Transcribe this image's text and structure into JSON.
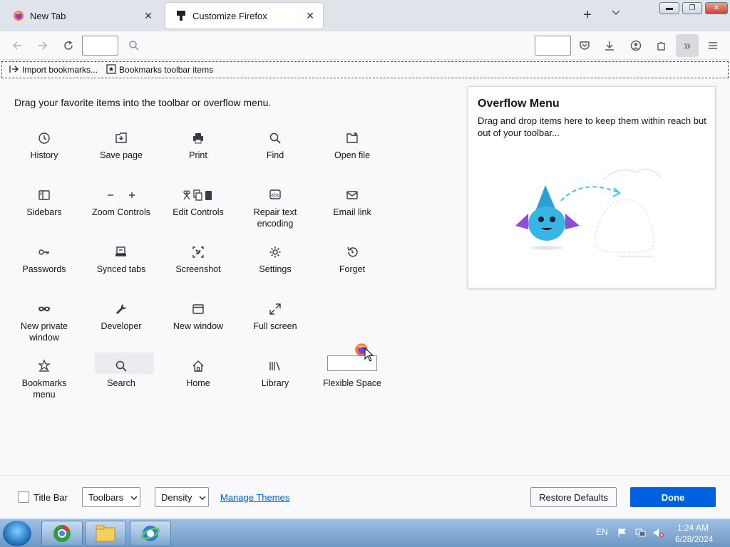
{
  "tabs": [
    {
      "label": "New Tab",
      "active": false
    },
    {
      "label": "Customize Firefox",
      "active": true
    }
  ],
  "bookmarks": [
    {
      "label": "Import bookmarks...",
      "icon": "import-icon"
    },
    {
      "label": "Bookmarks toolbar items",
      "icon": "star-box-icon"
    }
  ],
  "palette": {
    "title": "Drag your favorite items into the toolbar or overflow menu.",
    "items": [
      {
        "label": "History",
        "icon": "clock-icon"
      },
      {
        "label": "Save page",
        "icon": "save-page-icon"
      },
      {
        "label": "Print",
        "icon": "printer-icon"
      },
      {
        "label": "Find",
        "icon": "magnifier-icon"
      },
      {
        "label": "Open file",
        "icon": "open-file-icon"
      },
      {
        "label": "Sidebars",
        "icon": "sidebar-icon"
      },
      {
        "label": "Zoom Controls",
        "icon": "zoom-icon"
      },
      {
        "label": "Edit Controls",
        "icon": "edit-controls-icon"
      },
      {
        "label": "Repair text encoding",
        "icon": "text-encoding-icon"
      },
      {
        "label": "Email link",
        "icon": "envelope-icon"
      },
      {
        "label": "Passwords",
        "icon": "key-icon"
      },
      {
        "label": "Synced tabs",
        "icon": "synced-tabs-icon"
      },
      {
        "label": "Screenshot",
        "icon": "screenshot-icon"
      },
      {
        "label": "Settings",
        "icon": "gear-icon"
      },
      {
        "label": "Forget",
        "icon": "forget-icon"
      },
      {
        "label": "New private window",
        "icon": "mask-icon"
      },
      {
        "label": "Developer",
        "icon": "wrench-icon"
      },
      {
        "label": "New window",
        "icon": "window-icon"
      },
      {
        "label": "Full screen",
        "icon": "expand-icon"
      },
      {
        "label": "Bookmarks menu",
        "icon": "bookmarks-menu-icon"
      },
      {
        "label": "Search",
        "icon": "magnifier-icon"
      },
      {
        "label": "Home",
        "icon": "home-icon"
      },
      {
        "label": "Library",
        "icon": "library-icon"
      },
      {
        "label": "Flexible Space",
        "icon": "flexible-space-icon"
      }
    ]
  },
  "overflow": {
    "title": "Overflow Menu",
    "description": "Drag and drop items here to keep them within reach but out of your toolbar..."
  },
  "footer": {
    "title_bar_label": "Title Bar",
    "toolbars_label": "Toolbars",
    "density_label": "Density",
    "manage_themes": "Manage Themes",
    "restore_defaults": "Restore Defaults",
    "done": "Done"
  },
  "taskbar": {
    "language": "EN",
    "time": "1:24 AM",
    "date": "6/28/2024"
  },
  "colors": {
    "accent": "#0061e0",
    "tabstrip": "#dfe3ea"
  }
}
